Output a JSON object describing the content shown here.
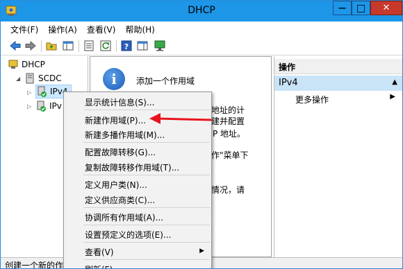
{
  "window": {
    "title": "DHCP",
    "close_glyph": "✕",
    "max_glyph": "□",
    "min_glyph": "—"
  },
  "menubar": {
    "items": [
      "文件(F)",
      "操作(A)",
      "查看(V)",
      "帮助(H)"
    ]
  },
  "toolbar": {
    "icons": [
      "back-icon",
      "forward-icon",
      "up-folder-icon",
      "show-hide-tree-icon",
      "properties-icon",
      "refresh-icon",
      "help-icon",
      "action-pane-icon",
      "monitor-icon"
    ]
  },
  "tree": {
    "root": "DHCP",
    "server": "SCDC",
    "ipv4": "IPv4",
    "ipv6": "IPv"
  },
  "center": {
    "title": "添加一个作用域",
    "fragments": [
      "地址的计",
      "建并配置",
      "P 地址。",
      "作\"菜单下",
      "情况，请"
    ]
  },
  "actions": {
    "header": "操作",
    "section": "IPv4",
    "items": [
      "更多操作"
    ]
  },
  "status": {
    "text": "创建一个新的作"
  },
  "context_menu": {
    "items": [
      "显示统计信息(S)...",
      "新建作用域(P)...",
      "新建多播作用域(M)...",
      "配置故障转移(G)...",
      "复制故障转移作用域(T)...",
      "定义用户类(N)...",
      "定义供应商类(C)...",
      "协调所有作用域(A)...",
      "设置预定义的选项(E)...",
      "查看(V)",
      "刷新(F)"
    ]
  },
  "colors": {
    "titlebar": "#1d96e8",
    "close": "#c7392b",
    "selection": "#cde8ff",
    "annotation": "#e8141c"
  }
}
